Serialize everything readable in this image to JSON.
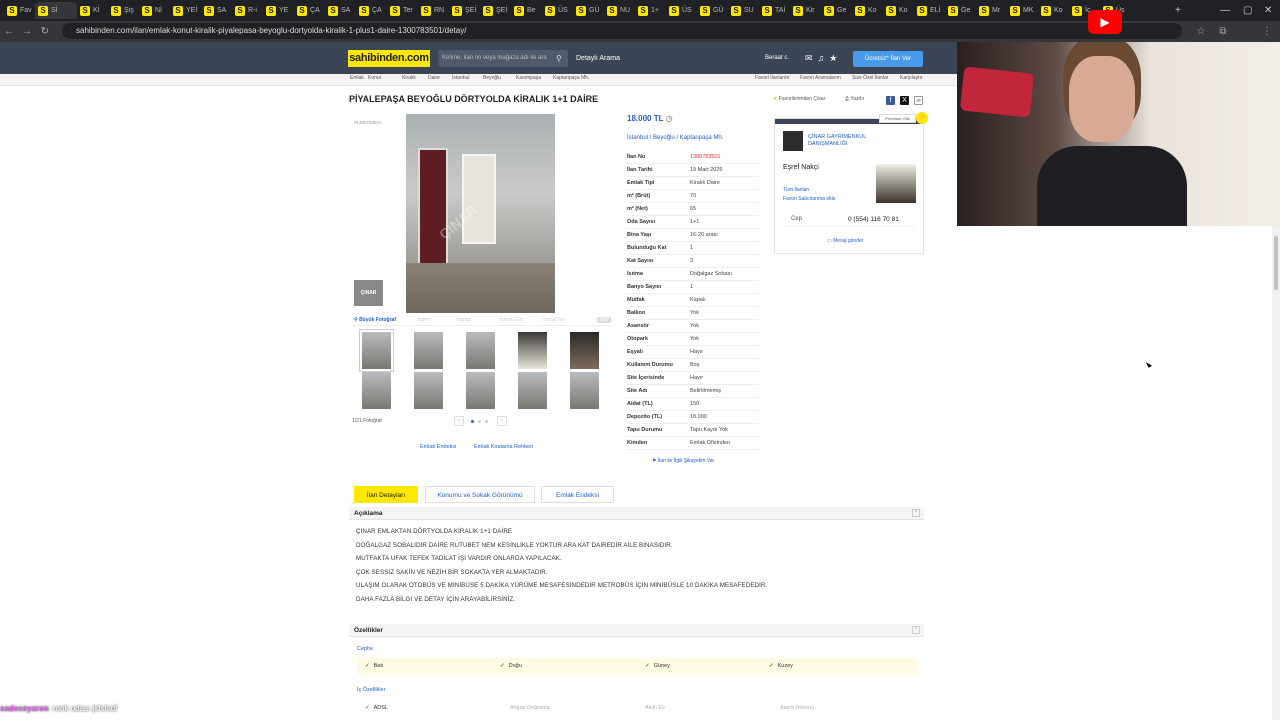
{
  "browser": {
    "tabs": [
      "Fav",
      "Sİ",
      "Kİ",
      "Şiş",
      "Nİ",
      "YEİ",
      "SA",
      "R-i",
      "YE",
      "ÇA",
      "SA",
      "ÇA",
      "Ter",
      "RN",
      "ŞEİ",
      "ŞEİ",
      "Be",
      "ÜS",
      "GÜ",
      "NU",
      "1+",
      "ÜS",
      "GÜ",
      "SU",
      "TAİ",
      "Kir",
      "Ge",
      "Ko",
      "Ko",
      "ELİ",
      "Ge",
      "Mr",
      "MK",
      "Ko",
      "İç",
      "Üs"
    ],
    "url": "sahibinden.com/ilan/emlak-konut-kiralik-piyalepasa-beyoglu-dortyolda-kiralik-1-plus1-daire-1300783501/detay/"
  },
  "header": {
    "logo": "sahibinden.com",
    "search_placeholder": "Kelime, ilan no veya mağaza adı ile ara",
    "advanced_search": "Detaylı Arama",
    "user": "Beraat c.",
    "post_ad": "Ücretsiz* İlan Ver"
  },
  "breadcrumb": [
    "Emlak",
    "Konut",
    "Kiralık",
    "Daire",
    "İstanbul",
    "Beyoğlu",
    "Kasımpaşa",
    "Kaptanpaşa Mh."
  ],
  "right_links": [
    "Favori İlanlarım",
    "Favori Aramalarım",
    "Size Özel İlanlar",
    "Karşılaştır"
  ],
  "listing": {
    "title": "PİYALEPAŞA BEYOĞLU DÖRTYOLDA KİRALIK 1+1 DAİRE",
    "id_label": "#1300783501",
    "fav_link": "Favorilerimden Çıkar",
    "print_link": "Yazdır",
    "big_photo": "Büyük Fotoğraf",
    "photo_tools": [
      "Video",
      "Harita",
      "Sokak Gör.",
      "Sanal Tur",
      "360°"
    ],
    "photo_count": "1/21 Fotoğraf",
    "links": [
      "Emlak Endeksi",
      "Emlak Kiralama Rehberi"
    ],
    "price": "18.000 TL",
    "location": [
      "İstanbul",
      "Beyoğlu",
      "Kaptanpaşa Mh."
    ],
    "attributes": [
      {
        "k": "İlan No",
        "v": "1300783501"
      },
      {
        "k": "İlan Tarihi",
        "v": "19 Mart 2026"
      },
      {
        "k": "Emlak Tipi",
        "v": "Kiralık Daire"
      },
      {
        "k": "m² (Brüt)",
        "v": "70"
      },
      {
        "k": "m² (Net)",
        "v": "65"
      },
      {
        "k": "Oda Sayısı",
        "v": "1+1"
      },
      {
        "k": "Bina Yaşı",
        "v": "16-20 arası"
      },
      {
        "k": "Bulunduğu Kat",
        "v": "1"
      },
      {
        "k": "Kat Sayısı",
        "v": "3"
      },
      {
        "k": "Isıtma",
        "v": "Doğalgaz Sobası"
      },
      {
        "k": "Banyo Sayısı",
        "v": "1"
      },
      {
        "k": "Mutfak",
        "v": "Kapalı"
      },
      {
        "k": "Balkon",
        "v": "Yok"
      },
      {
        "k": "Asansör",
        "v": "Yok"
      },
      {
        "k": "Otopark",
        "v": "Yok"
      },
      {
        "k": "Eşyalı",
        "v": "Hayır"
      },
      {
        "k": "Kullanım Durumu",
        "v": "Boş"
      },
      {
        "k": "Site İçerisinde",
        "v": "Hayır"
      },
      {
        "k": "Site Adı",
        "v": "Belirtilmemiş"
      },
      {
        "k": "Aidat (TL)",
        "v": "150"
      },
      {
        "k": "Depozito (TL)",
        "v": "18.000"
      },
      {
        "k": "Tapu Durumu",
        "v": "Tapu Kaydı Yok"
      },
      {
        "k": "Kimden",
        "v": "Emlak Ofisinden"
      }
    ],
    "complaint": "İlan ile İlgili Şikayetim Var"
  },
  "store": {
    "name": "ÇINAR GAYRİMENKUL DANIŞMANLIĞI",
    "premium": "Premium Ofis",
    "agent": "Eşref Nakçi",
    "all_ads": "Tüm İlanları",
    "add_fav": "Favori Satıcılarıma ekle",
    "phone_label": "Cep",
    "phone": "0 (554) 116 70 81",
    "message": "Mesaj gönder",
    "logo_text": "ÇINAR"
  },
  "detail_tabs": [
    "İlan Detayları",
    "Konumu ve Sokak Görünümü",
    "Emlak Endeksi"
  ],
  "description": {
    "title": "Açıklama",
    "lines": [
      "ÇINAR EMLAKTAN DÖRTYOLDA KİRALIK 1+1 DAİRE",
      "DOĞALGAZ SOBALIDIR DAİRE RUTUBET NEM KESİNLİKLE YOKTUR ARA KAT DAİREDİR AİLE BİNASIDIR.",
      "MUTFAKTA UFAK TEFEK TADİLAT İŞİ VARDIR ONLARDA YAPILACAK.",
      "ÇOK SESSİZ SAKİN VE NEZİH BİR SOKAKTA YER ALMAKTADIR.",
      "ULAŞIM OLARAK OTOBÜS VE MİNİBÜSE 5 DAKİKA YÜRÜME MESAFESİNDEDİR METROBÜS İÇİN MİNİBÜSLE 10 DAKİKA MESAFEDEDİR.",
      "DAHA FAZLA BİLGİ VE DETAY İÇİN ARAYABİLİRSİNİZ."
    ]
  },
  "features": {
    "title": "Özellikler",
    "cephe_label": "Cephe",
    "cephe": [
      "Batı",
      "Doğu",
      "Güney",
      "Kuzey"
    ],
    "ic_label": "İç Özellikler",
    "ic": [
      {
        "t": "ADSL",
        "on": true
      },
      {
        "t": "Ahşap Doğrama",
        "on": false
      },
      {
        "t": "Akıllı Ev",
        "on": false
      },
      {
        "t": "Alarm (Hırsız)",
        "on": false
      }
    ]
  },
  "chat": {
    "user": "sadeceyaren",
    "text": ": rank odası jkfsfsdf"
  }
}
